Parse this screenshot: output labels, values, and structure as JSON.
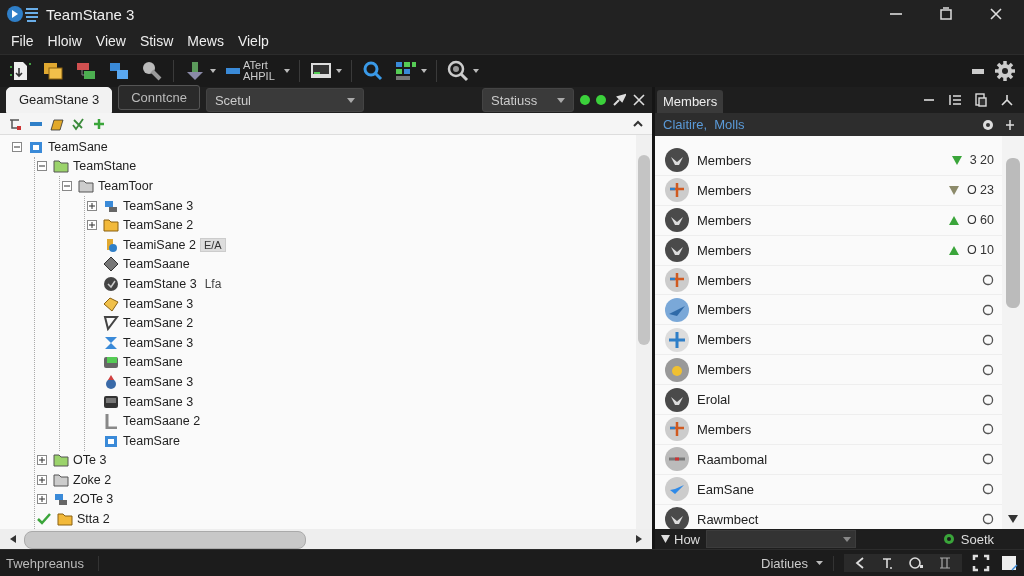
{
  "window": {
    "title": "TeamStane 3"
  },
  "menu": [
    "File",
    "Hloiw",
    "View",
    "Stisw",
    "Mews",
    "Vielp"
  ],
  "toolbar": {
    "text_button": {
      "lines": [
        "ATert",
        "AHPIL"
      ]
    }
  },
  "doc_tabs": [
    {
      "label": "GeamStane 3",
      "selected": true
    },
    {
      "label": "Conntcne",
      "selected": false
    }
  ],
  "scope_dropdown": {
    "value": "Scetul"
  },
  "status_dropdown": {
    "value": "Statiuss"
  },
  "tree": [
    {
      "label": "TeamSane",
      "expanded": true,
      "children": [
        {
          "label": "TeamStane",
          "expanded": true,
          "children": [
            {
              "label": "TeamToor",
              "expanded": true,
              "children": [
                {
                  "label": "TeamSane 3",
                  "expanded": false
                },
                {
                  "label": "TeamSane 2",
                  "expanded": false
                },
                {
                  "label": "TeamiSane 2",
                  "badge": "E/A"
                },
                {
                  "label": "TeamSaane"
                },
                {
                  "label": "TeamStane 3",
                  "note": "Lfa"
                },
                {
                  "label": "TeamSane 3"
                },
                {
                  "label": "TeamSane 2"
                },
                {
                  "label": "TeamSane 3"
                },
                {
                  "label": "TeamSane"
                },
                {
                  "label": "TeamSane 3"
                },
                {
                  "label": "TeamSane 3"
                },
                {
                  "label": "TeamSaane 2"
                },
                {
                  "label": "TeamSare"
                }
              ]
            }
          ]
        },
        {
          "label": "OTe 3",
          "expanded": false
        },
        {
          "label": "Zoke 2",
          "expanded": false
        },
        {
          "label": "2OTe 3",
          "expanded": false
        },
        {
          "label": "Stta 2",
          "checked": true
        }
      ]
    }
  ],
  "members_panel": {
    "title": "Members",
    "filter_text": "Claitire,  Molls",
    "rows": [
      {
        "name": "Members",
        "value": "3 20",
        "rising": false,
        "color": "#3aa53a"
      },
      {
        "name": "Members",
        "value": "O 23",
        "rising": false,
        "color": "#8c8a6a"
      },
      {
        "name": "Members",
        "value": "O 60",
        "rising": true,
        "color": "#3aa53a"
      },
      {
        "name": "Members",
        "value": "O 10",
        "rising": true,
        "color": "#3aa53a"
      },
      {
        "name": "Members"
      },
      {
        "name": "Members"
      },
      {
        "name": "Members"
      },
      {
        "name": "Members"
      },
      {
        "name": "Erolal"
      },
      {
        "name": "Members"
      },
      {
        "name": "Raambomal"
      },
      {
        "name": "EamSane"
      },
      {
        "name": "Rawmbect"
      }
    ],
    "footer": {
      "toggle": "How",
      "expanded": true,
      "action": "Soetk"
    }
  },
  "status_bar": {
    "text": "Twehpreanus",
    "dropdown": "Diatiues"
  }
}
